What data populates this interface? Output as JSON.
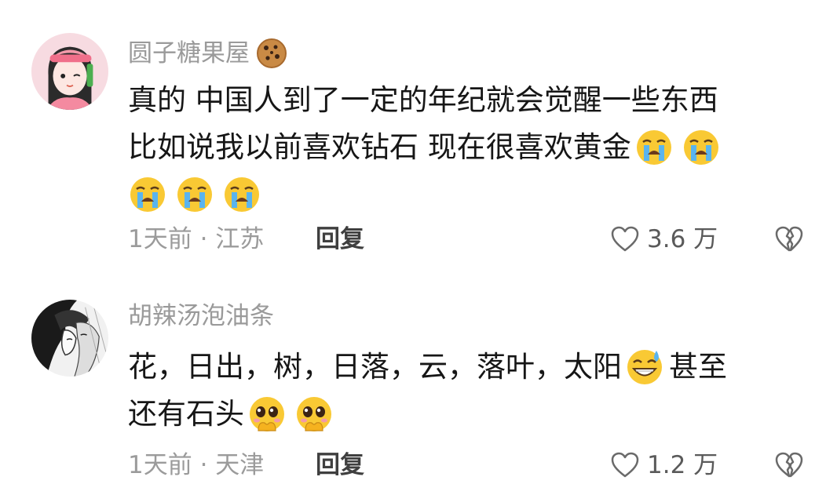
{
  "comments": [
    {
      "username": "圆子糖果屋",
      "badge_icon": "cookie-icon",
      "lines": [
        {
          "text": "真的 中国人到了一定的年纪就会觉醒一些东西",
          "emojis": []
        },
        {
          "text": "比如说我以前喜欢钻石 现在很喜欢黄金",
          "emojis": [
            "crying-face",
            "crying-face"
          ]
        },
        {
          "text": "",
          "emojis": [
            "crying-face",
            "crying-face",
            "crying-face"
          ]
        }
      ],
      "time_location": "1天前 · 江苏",
      "reply_label": "回复",
      "likes": "3.6 万"
    },
    {
      "username": "胡辣汤泡油条",
      "lines": [
        {
          "text": "花，日出，树，日落，云，落叶，太阳",
          "emojis": [
            "grinning-sweat-face"
          ],
          "tail": "甚至"
        },
        {
          "text": "还有石头",
          "emojis": [
            "pleading-face",
            "pleading-face"
          ]
        }
      ],
      "time_location": "1天前 · 天津",
      "reply_label": "回复",
      "likes": "1.2 万"
    }
  ]
}
